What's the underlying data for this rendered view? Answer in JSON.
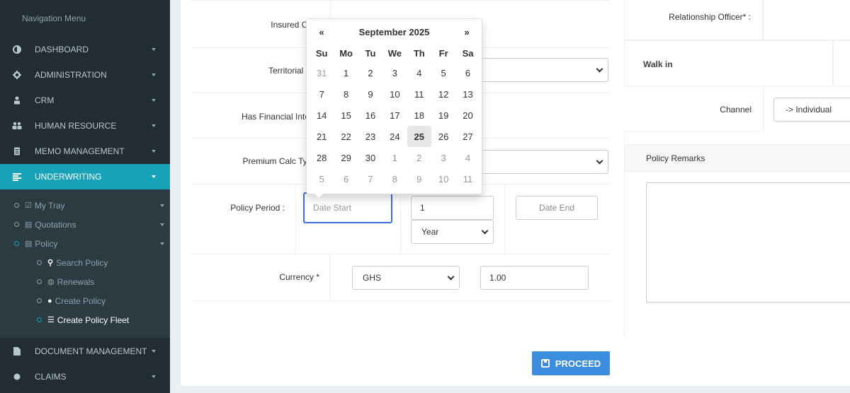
{
  "sidebar": {
    "header": "Navigation Menu",
    "items": [
      {
        "label": "DASHBOARD",
        "icon": "dashboard-icon"
      },
      {
        "label": "ADMINISTRATION",
        "icon": "gear-icon"
      },
      {
        "label": "CRM",
        "icon": "crm-icon"
      },
      {
        "label": "HUMAN RESOURCE",
        "icon": "users-icon"
      },
      {
        "label": "MEMO MANAGEMENT",
        "icon": "memo-icon"
      },
      {
        "label": "UNDERWRITING",
        "icon": "list-icon"
      }
    ],
    "underwriting_sub": [
      {
        "label": "My Tray",
        "icon": "check-square-icon"
      },
      {
        "label": "Quotations",
        "icon": "document-icon"
      },
      {
        "label": "Policy",
        "icon": "document-icon"
      }
    ],
    "policy_sub": [
      {
        "label": "Search Policy",
        "icon": "search-icon"
      },
      {
        "label": "Renewals",
        "icon": "renew-icon"
      },
      {
        "label": "Create Policy",
        "icon": "plus-circle-icon"
      },
      {
        "label": "Create Policy Fleet",
        "icon": "list-icon"
      }
    ],
    "bottom_items": [
      {
        "label": "DOCUMENT MANAGEMENT",
        "icon": "file-icon"
      },
      {
        "label": "CLAIMS",
        "icon": "claims-icon"
      }
    ]
  },
  "form": {
    "insured_label": "Insured Co",
    "territorial_label": "Territorial Li",
    "financial_label": "Has Financial Inter",
    "premium_label": "Premium Calc Type",
    "policy_period_label": "Policy Period :",
    "date_start_placeholder": "Date Start",
    "period_count": "1",
    "period_unit": "Year",
    "date_end_placeholder": "Date End",
    "currency_label": "Currency *",
    "currency_value": "GHS",
    "exchange_rate": "1.00",
    "proceed_label": "PROCEED"
  },
  "right_panel": {
    "relationship_label": "Relationship Officer* :",
    "walk_in": "Walk in",
    "channel_label": "Channel",
    "channel_value": "-> Individual",
    "remarks_label": "Policy Remarks"
  },
  "datepicker": {
    "prev": "«",
    "next": "»",
    "title": "September 2025",
    "weekdays": [
      "Su",
      "Mo",
      "Tu",
      "We",
      "Th",
      "Fr",
      "Sa"
    ],
    "weeks": [
      [
        "31",
        "1",
        "2",
        "3",
        "4",
        "5",
        "6"
      ],
      [
        "7",
        "8",
        "9",
        "10",
        "11",
        "12",
        "13"
      ],
      [
        "14",
        "15",
        "16",
        "17",
        "18",
        "19",
        "20"
      ],
      [
        "21",
        "22",
        "23",
        "24",
        "25",
        "26",
        "27"
      ],
      [
        "28",
        "29",
        "30",
        "1",
        "2",
        "3",
        "4"
      ],
      [
        "5",
        "6",
        "7",
        "8",
        "9",
        "10",
        "11"
      ]
    ],
    "today": "25"
  }
}
